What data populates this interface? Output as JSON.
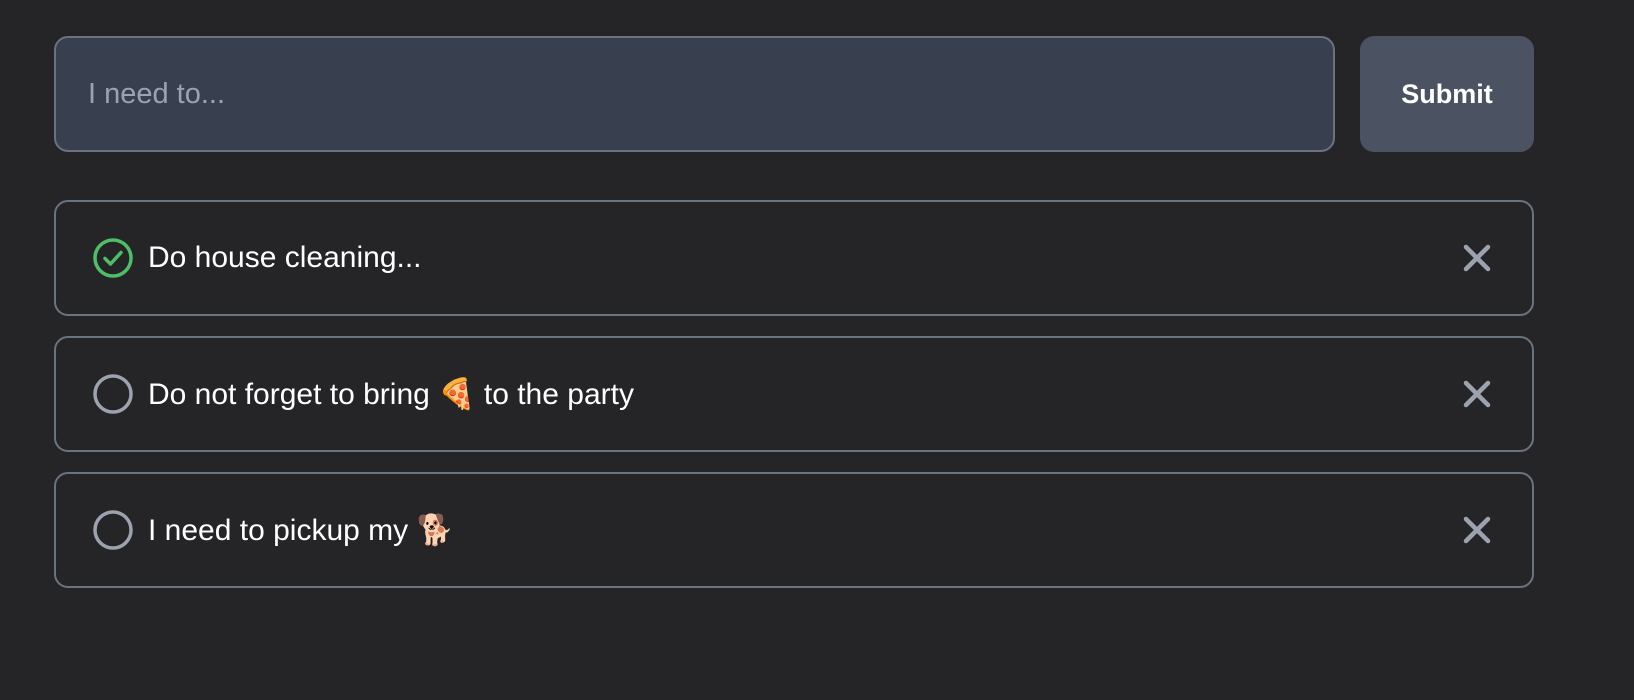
{
  "form": {
    "input_value": "",
    "input_placeholder": "I need to...",
    "submit_label": "Submit"
  },
  "todos": [
    {
      "text": "Do house cleaning...",
      "completed": true
    },
    {
      "text": "Do not forget to bring 🍕 to the party",
      "completed": false
    },
    {
      "text": "I need to pickup my 🐕",
      "completed": false
    }
  ],
  "icons": {
    "completed": "check-circle-icon",
    "incomplete": "circle-icon",
    "delete": "close-icon"
  },
  "colors": {
    "background": "#252528",
    "input_background": "#384050",
    "button_background": "#4b5262",
    "border": "#6b7280",
    "completed_green": "#4fbf67",
    "muted_icon": "#9ca3af",
    "text": "#ffffff"
  }
}
